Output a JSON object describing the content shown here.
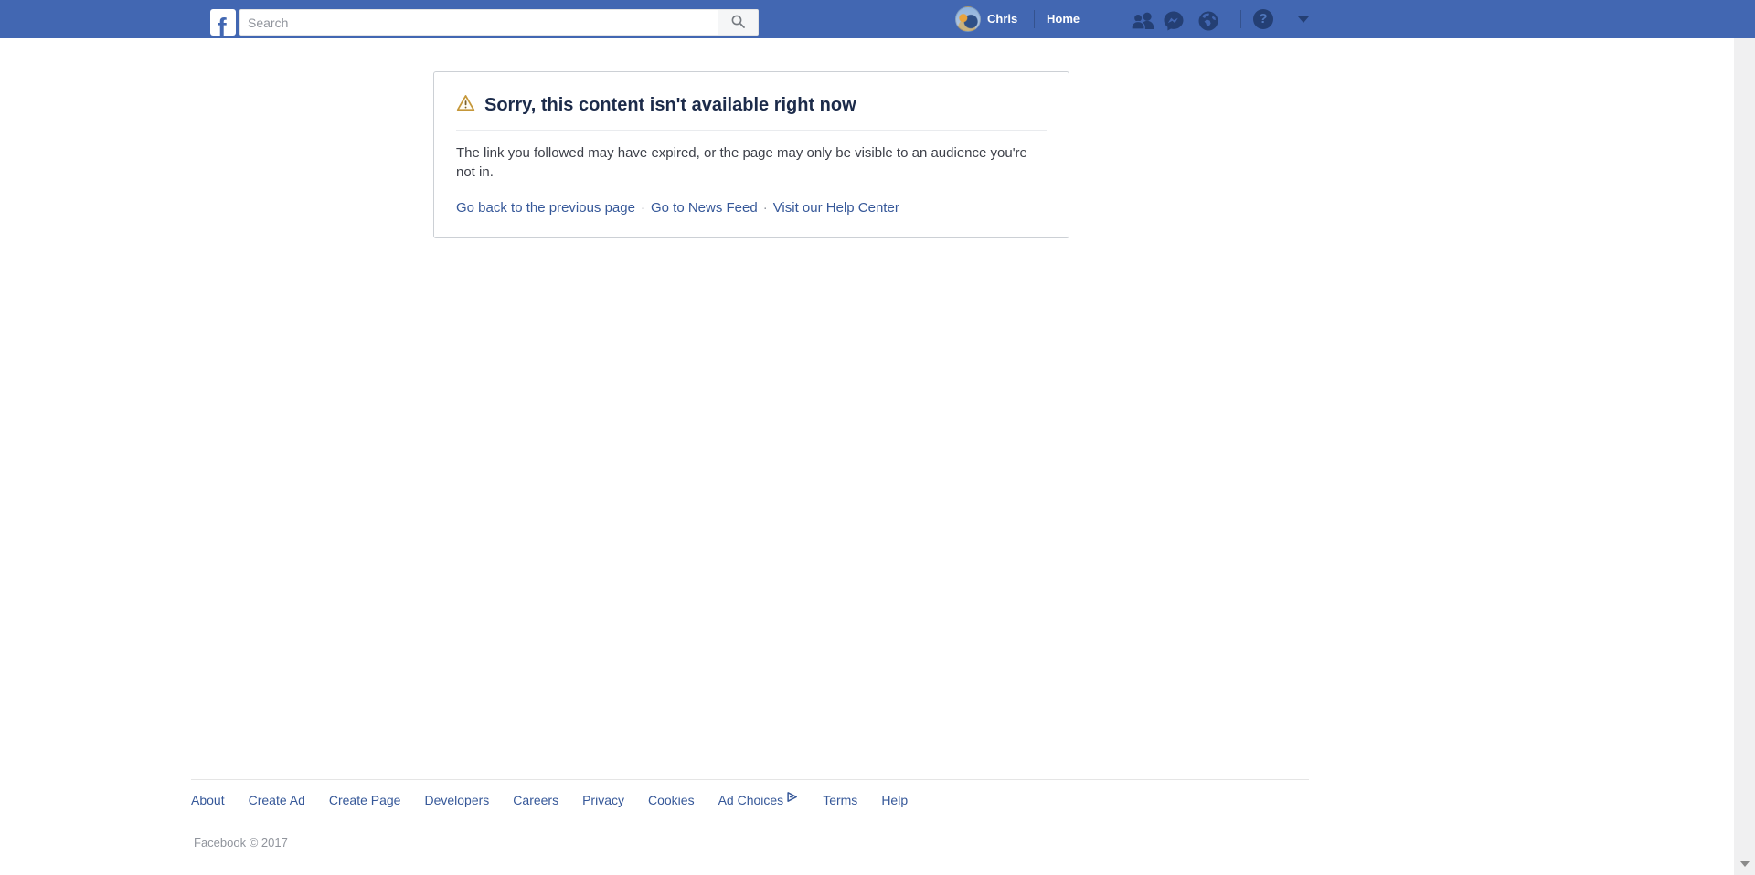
{
  "navbar": {
    "logo_letter": "f",
    "search": {
      "placeholder": "Search"
    },
    "user": {
      "name": "Chris"
    },
    "home_label": "Home"
  },
  "error_card": {
    "title": "Sorry, this content isn't available right now",
    "body": "The link you followed may have expired, or the page may only be visible to an audience you're not in.",
    "links": [
      "Go back to the previous page",
      "Go to News Feed",
      "Visit our Help Center"
    ],
    "separator": "·"
  },
  "footer": {
    "links": [
      "About",
      "Create Ad",
      "Create Page",
      "Developers",
      "Careers",
      "Privacy",
      "Cookies",
      "Ad Choices",
      "Terms",
      "Help"
    ],
    "copyright": "Facebook © 2017"
  },
  "icons": {
    "logo": "facebook-logo",
    "search": "search-icon",
    "friends": "friend-requests-icon",
    "messenger": "messenger-icon",
    "notifications": "notifications-globe-icon",
    "help": "help-icon",
    "account_menu": "chevron-down-icon",
    "warning": "warning-triangle-icon",
    "adchoices": "adchoices-icon",
    "scroll_down": "scroll-down-arrow-icon"
  },
  "colors": {
    "navbar_bg": "#4267b2",
    "navbar_icon": "#243f74",
    "link_blue": "#365899",
    "heading_text": "#1c2b4a",
    "body_text": "#3d4049",
    "muted_gray": "#90949c",
    "warning_amber": "#c59739",
    "card_border": "#ccd0d5"
  }
}
